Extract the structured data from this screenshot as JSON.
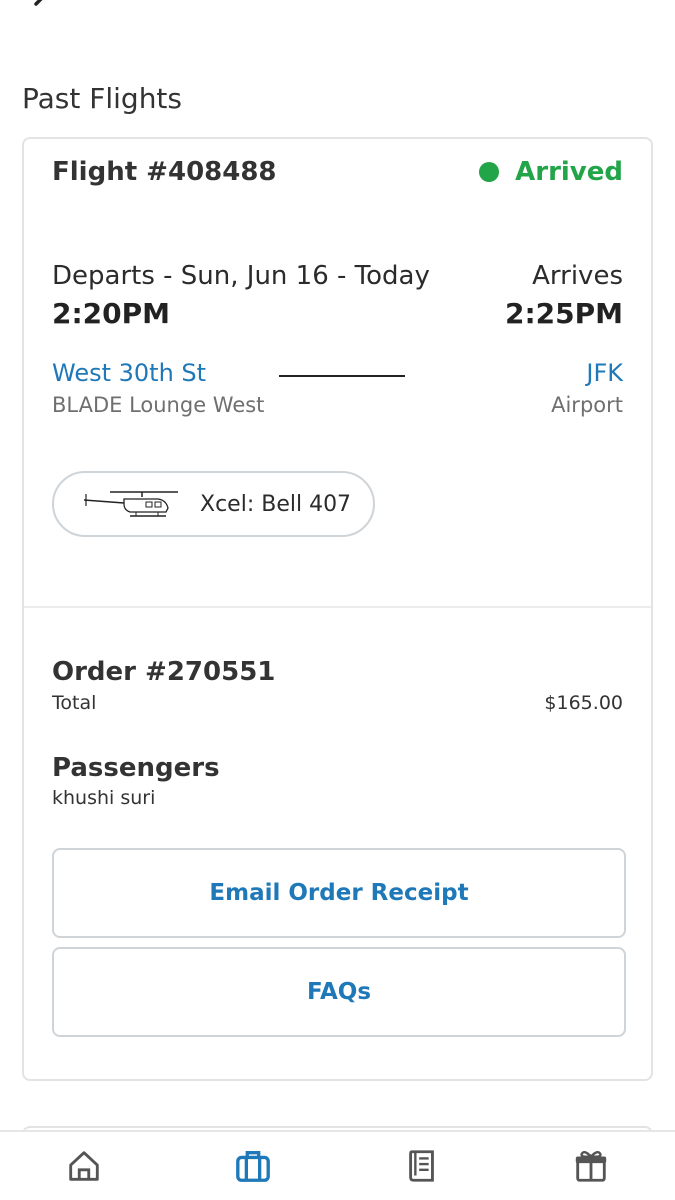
{
  "header": {
    "section_title": "Past Flights"
  },
  "flight": {
    "title": "Flight #408488",
    "status": "Arrived",
    "status_color": "#22a448",
    "departs_label": "Departs - Sun, Jun 16 - Today",
    "departs_time": "2:20PM",
    "arrives_label": "Arrives",
    "arrives_time": "2:25PM",
    "origin": {
      "name": "West 30th St",
      "sub": "BLADE Lounge West"
    },
    "destination": {
      "name": "JFK",
      "sub": "Airport"
    },
    "aircraft": "Xcel: Bell 407"
  },
  "order": {
    "title": "Order #270551",
    "total_label": "Total",
    "total_value": "$165.00",
    "passengers_title": "Passengers",
    "passenger_name": "khushi suri"
  },
  "buttons": {
    "email_receipt": "Email Order Receipt",
    "faqs": "FAQs"
  },
  "tabbar": {
    "items": [
      {
        "icon": "home-icon",
        "active": false
      },
      {
        "icon": "briefcase-icon",
        "active": true
      },
      {
        "icon": "book-icon",
        "active": false
      },
      {
        "icon": "gift-icon",
        "active": false
      }
    ],
    "active_color": "#1f78b8",
    "inactive_color": "#555555"
  }
}
